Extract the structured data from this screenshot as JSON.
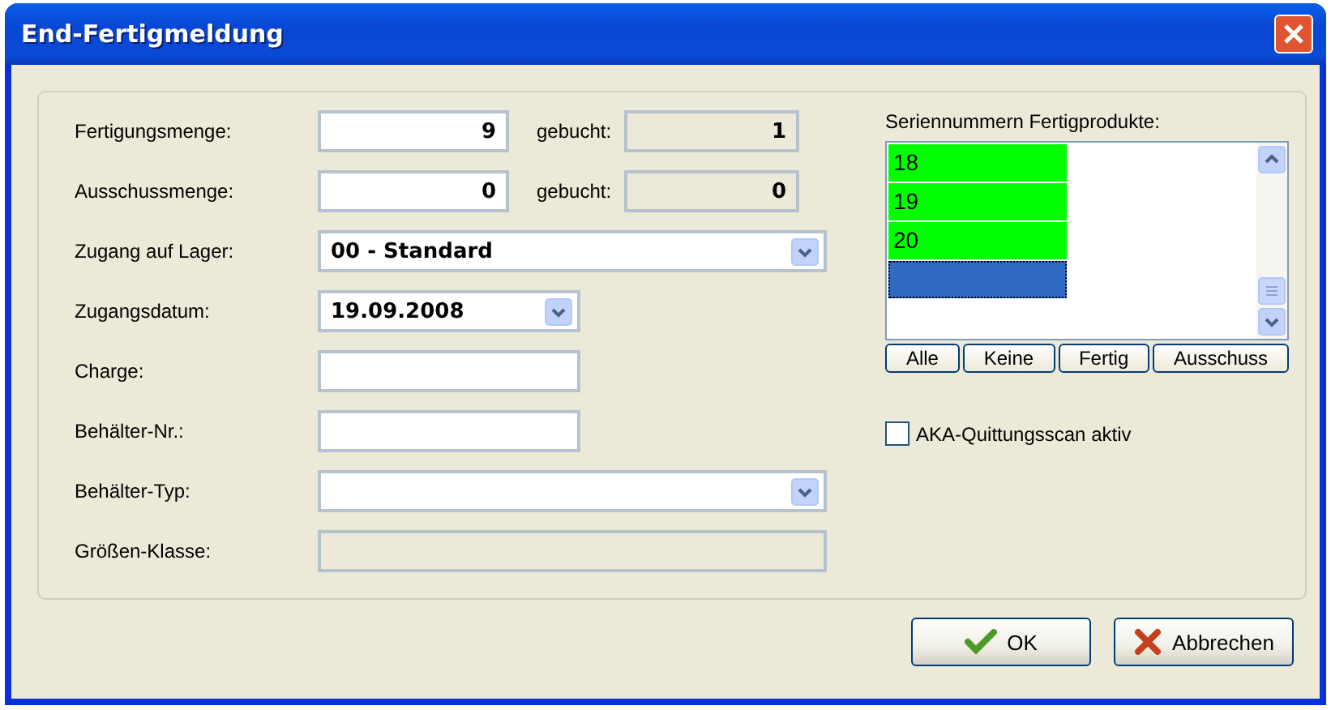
{
  "window": {
    "title": "End-Fertigmeldung"
  },
  "fields": [
    {
      "kind": "quantity",
      "label": "Fertigungsmenge:",
      "value": "9",
      "booked_label": "gebucht:",
      "booked": "1"
    },
    {
      "kind": "quantity",
      "label": "Ausschussmenge:",
      "value": "0",
      "booked_label": "gebucht:",
      "booked": "0"
    },
    {
      "kind": "combo",
      "label": "Zugang auf Lager:",
      "value": "00 - Standard"
    },
    {
      "kind": "date",
      "label": "Zugangsdatum:",
      "value": "19.09.2008"
    },
    {
      "kind": "text",
      "label": "Charge:"
    },
    {
      "kind": "text",
      "label": "Behälter-Nr.:"
    },
    {
      "kind": "combo",
      "label": "Behälter-Typ:"
    },
    {
      "kind": "readonly",
      "label": "Größen-Klasse:"
    }
  ],
  "serials": {
    "label": "Seriennummern Fertigprodukte:",
    "items": [
      {
        "text": "18",
        "selected": false,
        "color": "#00ff00"
      },
      {
        "text": "19",
        "selected": false,
        "color": "#00ff00"
      },
      {
        "text": "20",
        "selected": false,
        "color": "#00ff00"
      },
      {
        "selected": true
      }
    ],
    "buttons": [
      "Alle",
      "Keine",
      "Fertig",
      "Ausschuss"
    ]
  },
  "aka_scan": {
    "label": "AKA-Quittungsscan aktiv",
    "checked": false
  },
  "buttons": [
    {
      "kind": "ok",
      "label": "OK"
    },
    {
      "kind": "cancel",
      "label": "Abbrechen"
    }
  ]
}
